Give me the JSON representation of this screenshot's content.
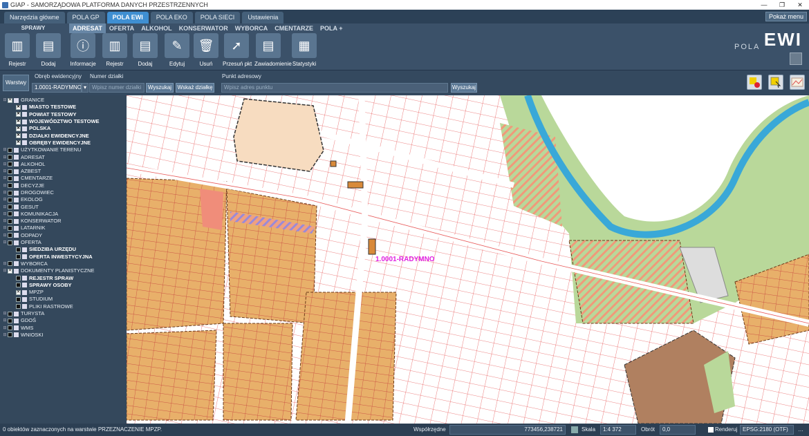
{
  "window": {
    "title": "GIAP - SAMORZĄDOWA PLATFORMA DANYCH PRZESTRZENNYCH"
  },
  "main_tabs": [
    {
      "label": "Narzędzia główne",
      "active": false
    },
    {
      "label": "POLA GP",
      "active": false
    },
    {
      "label": "POLA EWI",
      "active": true
    },
    {
      "label": "POLA EKO",
      "active": false
    },
    {
      "label": "POLA SIECI",
      "active": false
    },
    {
      "label": "Ustawienia",
      "active": false
    }
  ],
  "show_menu_label": "Pokaż menu",
  "ribbon": {
    "group_label": "SPRAWY",
    "sub_tabs": [
      "ADRESAT",
      "OFERTA",
      "ALKOHOL",
      "KONSERWATOR",
      "WYBORCA",
      "CMENTARZE",
      "POLA +"
    ],
    "buttons": [
      "Rejestr",
      "Dodaj",
      "Informacje",
      "Rejestr",
      "Dodaj",
      "Edytuj",
      "Usuń",
      "Przesuń pkt",
      "Zawiadomienie",
      "Statystyki"
    ],
    "logo": {
      "pola": "POLA",
      "ewi": "EWI"
    }
  },
  "search": {
    "layers_button": "Warstwy",
    "obreb_label": "Obręb ewidencyjny",
    "obreb_value": "1.0001-RADYMNO",
    "dzialka_label": "Numer działki",
    "dzialka_placeholder": "Wpisz numer działki",
    "search_btn": "Wyszukaj",
    "show_parcel_btn": "Wskaż działkę",
    "address_label": "Punkt adresowy",
    "address_placeholder": "Wpisz adres punktu",
    "search_btn2": "Wyszukaj"
  },
  "layers": [
    {
      "label": "GRANICE",
      "checked": true,
      "bold": false,
      "indent": 0
    },
    {
      "label": "MIASTO TESTOWE",
      "checked": true,
      "bold": true,
      "indent": 1
    },
    {
      "label": "POWIAT TESTOWY",
      "checked": true,
      "bold": true,
      "indent": 1
    },
    {
      "label": "WOJEWÓDZTWO TESTOWE",
      "checked": true,
      "bold": true,
      "indent": 1
    },
    {
      "label": "POLSKA",
      "checked": true,
      "bold": true,
      "indent": 1
    },
    {
      "label": "DZIAŁKI EWIDENCYJNE",
      "checked": true,
      "bold": true,
      "indent": 1
    },
    {
      "label": "OBRĘBY EWIDENCYJNE",
      "checked": true,
      "bold": true,
      "indent": 1
    },
    {
      "label": "UŻYTKOWANIE TERENU",
      "checked": false,
      "bold": false,
      "indent": 0
    },
    {
      "label": "ADRESAT",
      "checked": false,
      "bold": false,
      "indent": 0
    },
    {
      "label": "ALKOHOL",
      "checked": false,
      "bold": false,
      "indent": 0
    },
    {
      "label": "AZBEST",
      "checked": false,
      "bold": false,
      "indent": 0
    },
    {
      "label": "CMENTARZE",
      "checked": false,
      "bold": false,
      "indent": 0
    },
    {
      "label": "DECYZJE",
      "checked": false,
      "bold": false,
      "indent": 0
    },
    {
      "label": "DROGOWIEC",
      "checked": false,
      "bold": false,
      "indent": 0
    },
    {
      "label": "EKOLOG",
      "checked": false,
      "bold": false,
      "indent": 0
    },
    {
      "label": "GESUT",
      "checked": false,
      "bold": false,
      "indent": 0
    },
    {
      "label": "KOMUNIKACJA",
      "checked": false,
      "bold": false,
      "indent": 0
    },
    {
      "label": "KONSERWATOR",
      "checked": false,
      "bold": false,
      "indent": 0
    },
    {
      "label": "LATARNIK",
      "checked": false,
      "bold": false,
      "indent": 0
    },
    {
      "label": "ODPADY",
      "checked": false,
      "bold": false,
      "indent": 0
    },
    {
      "label": "OFERTA",
      "checked": false,
      "bold": false,
      "indent": 0
    },
    {
      "label": "SIEDZIBA URZĘDU",
      "checked": false,
      "bold": true,
      "indent": 1
    },
    {
      "label": "OFERTA INWESTYCYJNA",
      "checked": false,
      "bold": true,
      "indent": 1
    },
    {
      "label": "WYBORCA",
      "checked": false,
      "bold": false,
      "indent": 0
    },
    {
      "label": "DOKUMENTY PLANISTYCZNE",
      "checked": true,
      "bold": false,
      "indent": 0
    },
    {
      "label": "REJESTR SPRAW",
      "checked": false,
      "bold": true,
      "indent": 1
    },
    {
      "label": "SPRAWY OSOBY",
      "checked": false,
      "bold": true,
      "indent": 1
    },
    {
      "label": "MPZP",
      "checked": true,
      "bold": false,
      "indent": 1
    },
    {
      "label": "STUDIUM",
      "checked": false,
      "bold": false,
      "indent": 1
    },
    {
      "label": "PLIKI RASTROWE",
      "checked": false,
      "bold": false,
      "indent": 1
    },
    {
      "label": "TURYSTA",
      "checked": false,
      "bold": false,
      "indent": 0
    },
    {
      "label": "GDOŚ",
      "checked": false,
      "bold": false,
      "indent": 0
    },
    {
      "label": "WMS",
      "checked": false,
      "bold": false,
      "indent": 0
    },
    {
      "label": "WNIOSKI",
      "checked": false,
      "bold": false,
      "indent": 0
    }
  ],
  "map": {
    "label": "1.0001-RADYMNO",
    "label_color": "#e020e0"
  },
  "status": {
    "message": "0 obiektów zaznaczonych na warstwie PRZEZNACZENIE MPZP.",
    "coords_label": "Współrzędne",
    "coords": "773456,238721",
    "scale_label": "Skala",
    "scale": "1:4 372",
    "rotation_label": "Obrót",
    "rotation": "0,0",
    "render_label": "Renderuj",
    "crs": "EPSG:2180 (OTF)"
  }
}
